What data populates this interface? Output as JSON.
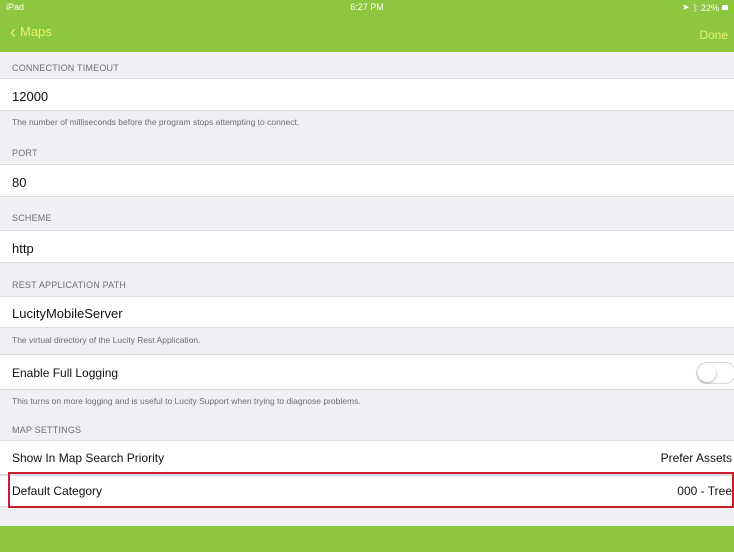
{
  "status": {
    "device": "iPad",
    "time": "6:27 PM",
    "battery": "22%"
  },
  "nav": {
    "back_label": "Maps",
    "done_label": "Done"
  },
  "sections": {
    "timeout_header": "CONNECTION TIMEOUT",
    "timeout_value": "12000",
    "timeout_footer": "The number of milliseconds before the program stops attempting to connect.",
    "port_header": "PORT",
    "port_value": "80",
    "scheme_header": "SCHEME",
    "scheme_value": "http",
    "rest_header": "REST APPLICATION PATH",
    "rest_value": "LucityMobileServer",
    "rest_footer": "The virtual directory of the Lucity Rest Application.",
    "logging_label": "Enable Full Logging",
    "logging_footer": "This turns on more logging and is useful to Lucity Support when trying to diagnose problems.",
    "map_header": "MAP SETTINGS",
    "search_priority_label": "Show In Map Search Priority",
    "search_priority_value": "Prefer Assets",
    "default_category_label": "Default Category",
    "default_category_value": "000 - Tree"
  },
  "logging_enabled": false
}
